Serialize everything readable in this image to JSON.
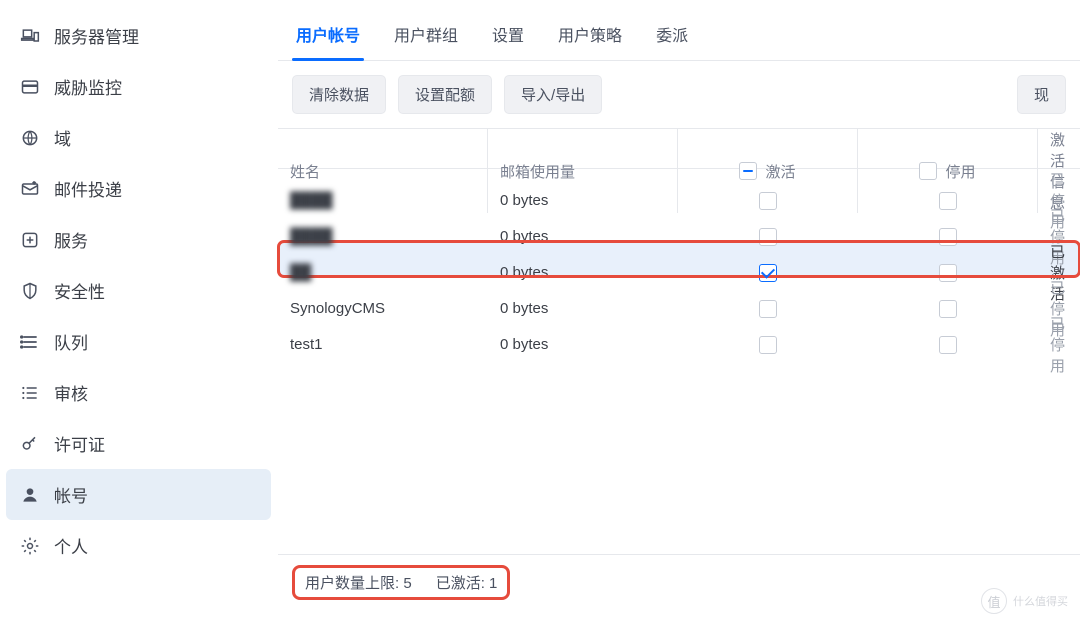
{
  "sidebar": {
    "items": [
      {
        "id": "server-mgmt",
        "label": "服务器管理",
        "icon": "devices-icon"
      },
      {
        "id": "threat-monitor",
        "label": "威胁监控",
        "icon": "card-icon"
      },
      {
        "id": "domain",
        "label": "域",
        "icon": "globe-icon"
      },
      {
        "id": "mail-delivery",
        "label": "邮件投递",
        "icon": "mail-out-icon"
      },
      {
        "id": "service",
        "label": "服务",
        "icon": "plus-box-icon"
      },
      {
        "id": "security",
        "label": "安全性",
        "icon": "shield-icon"
      },
      {
        "id": "queue",
        "label": "队列",
        "icon": "queue-icon"
      },
      {
        "id": "audit",
        "label": "审核",
        "icon": "list-icon"
      },
      {
        "id": "license",
        "label": "许可证",
        "icon": "key-icon"
      },
      {
        "id": "account",
        "label": "帐号",
        "icon": "user-icon"
      },
      {
        "id": "personal",
        "label": "个人",
        "icon": "gear-icon"
      }
    ],
    "active": "account"
  },
  "main": {
    "tabs": [
      {
        "id": "user-account",
        "label": "用户帐号"
      },
      {
        "id": "user-group",
        "label": "用户群组"
      },
      {
        "id": "settings",
        "label": "设置"
      },
      {
        "id": "user-policy",
        "label": "用户策略"
      },
      {
        "id": "delegate",
        "label": "委派"
      }
    ],
    "active_tab": "user-account",
    "toolbar": {
      "clear_data": "清除数据",
      "set_quota": "设置配额",
      "import_export": "导入/导出",
      "right_btn": "现"
    },
    "columns": {
      "name": "姓名",
      "mailbox_usage": "邮箱使用量",
      "activate": "激活",
      "disable": "停用",
      "activation_info": "激活信息"
    },
    "header_checkbox_state": {
      "activate": "indeterminate",
      "disable": "unchecked"
    },
    "rows": [
      {
        "name": "████",
        "blurred": true,
        "usage": "0 bytes",
        "activate": false,
        "disable": false,
        "status": "已停用",
        "selected": false
      },
      {
        "name": "████",
        "blurred": true,
        "usage": "0 bytes",
        "activate": false,
        "disable": false,
        "status": "已停用",
        "selected": false
      },
      {
        "name": "██",
        "blurred": true,
        "usage": "0 bytes",
        "activate": true,
        "disable": false,
        "status": "已激活",
        "selected": true,
        "highlighted": true
      },
      {
        "name": "SynologyCMS",
        "blurred": false,
        "usage": "0 bytes",
        "activate": false,
        "disable": false,
        "status": "已停用",
        "selected": false
      },
      {
        "name": "test1",
        "blurred": false,
        "usage": "0 bytes",
        "activate": false,
        "disable": false,
        "status": "已停用",
        "selected": false
      }
    ]
  },
  "footer": {
    "user_limit_label": "用户数量上限:",
    "user_limit_value": "5",
    "activated_label": "已激活:",
    "activated_value": "1"
  },
  "watermark": {
    "badge": "值",
    "text": "什么值得买"
  }
}
